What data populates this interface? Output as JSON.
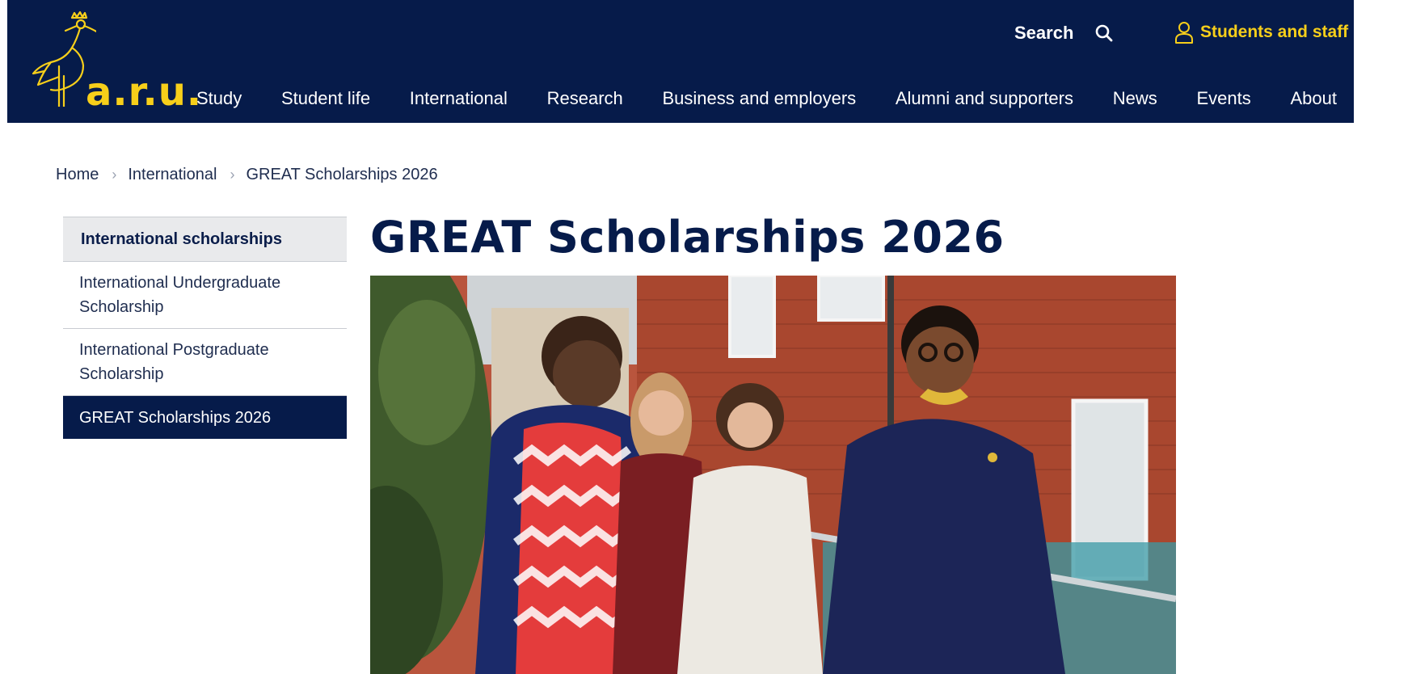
{
  "header": {
    "logo_text": "a.r.u.",
    "search_label": "Search",
    "students_label": "Students and staff",
    "nav": [
      "Study",
      "Student life",
      "International",
      "Research",
      "Business and employers",
      "Alumni and supporters",
      "News",
      "Events",
      "About"
    ]
  },
  "breadcrumb": [
    "Home",
    "International",
    "GREAT Scholarships 2026"
  ],
  "sidebar": {
    "heading": "International scholarships",
    "items": [
      {
        "label": "International Undergraduate Scholarship",
        "active": false
      },
      {
        "label": "International Postgraduate Scholarship",
        "active": false
      },
      {
        "label": "GREAT Scholarships 2026",
        "active": true
      }
    ]
  },
  "main": {
    "title": "GREAT Scholarships 2026"
  },
  "colors": {
    "navy": "#061b4a",
    "yellow": "#f7cf1a"
  },
  "icons": {
    "logo": "heron-logo-icon",
    "search": "search-icon",
    "user": "user-icon",
    "chevron": "chevron-right-icon"
  }
}
